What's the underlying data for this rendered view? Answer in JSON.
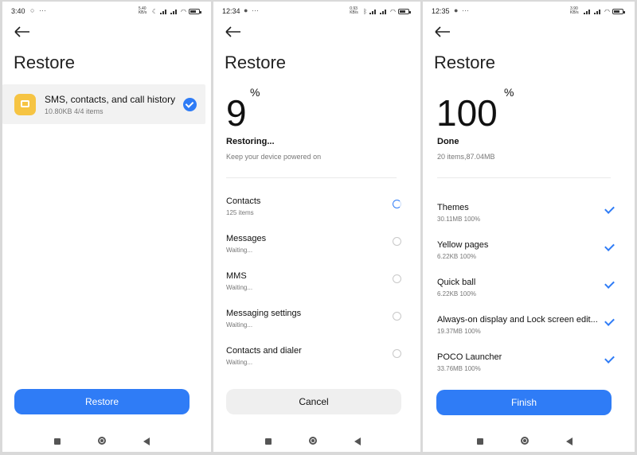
{
  "panel1": {
    "status": {
      "time": "3:40",
      "dots": "···",
      "net": "5.40 KB/s"
    },
    "title": "Restore",
    "item": {
      "title": "SMS, contacts, and call history",
      "subtitle": "10.80KB  4/4 items"
    },
    "button": "Restore"
  },
  "panel2": {
    "status": {
      "time": "12:34",
      "net": "0.93 KB/s"
    },
    "title": "Restore",
    "progress": {
      "value": "9",
      "unit": "%"
    },
    "state": "Restoring...",
    "note": "Keep your device powered on",
    "items": [
      {
        "name": "Contacts",
        "sub": "125 items"
      },
      {
        "name": "Messages",
        "sub": "Waiting..."
      },
      {
        "name": "MMS",
        "sub": "Waiting..."
      },
      {
        "name": "Messaging settings",
        "sub": "Waiting..."
      },
      {
        "name": "Contacts and dialer",
        "sub": "Waiting..."
      }
    ],
    "button": "Cancel"
  },
  "panel3": {
    "status": {
      "time": "12:35",
      "net": "3.90 KB/s"
    },
    "title": "Restore",
    "progress": {
      "value": "100",
      "unit": "%"
    },
    "state": "Done",
    "note": "20 items,87.04MB",
    "items": [
      {
        "name": "Themes",
        "sub": "30.11MB 100%"
      },
      {
        "name": "Yellow pages",
        "sub": "6.22KB 100%"
      },
      {
        "name": "Quick ball",
        "sub": "6.22KB 100%"
      },
      {
        "name": "Always-on display and Lock screen edit...",
        "sub": "19.37MB 100%"
      },
      {
        "name": "POCO Launcher",
        "sub": "33.76MB 100%"
      }
    ],
    "button": "Finish"
  },
  "colors": {
    "accent": "#2f7cf6",
    "sms_icon": "#f6c443"
  }
}
